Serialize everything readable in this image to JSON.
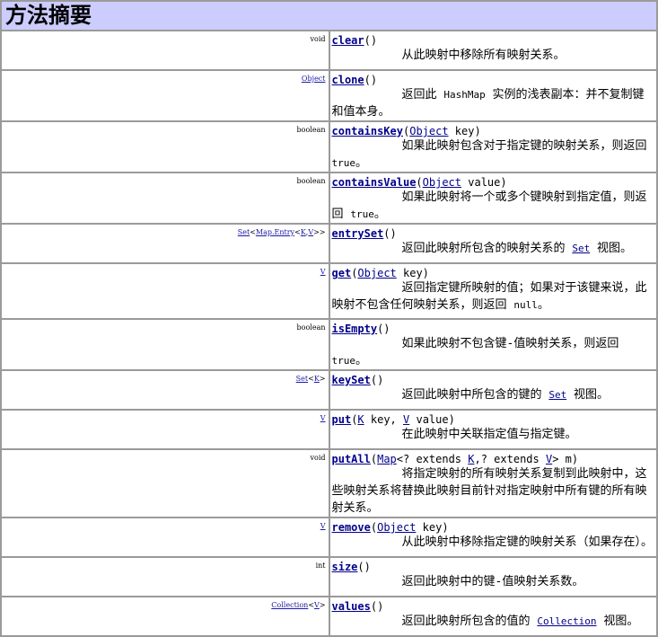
{
  "title": "方法摘要",
  "colors": {
    "header_bg": "#ccccff",
    "link": "#00008b",
    "border": "#9a9a9a"
  },
  "rows": [
    {
      "ret": [
        {
          "t": "void"
        }
      ],
      "name": "clear",
      "params": [
        {
          "t": "()"
        }
      ],
      "desc": [
        {
          "t": "从此映射中移除所有映射关系。"
        }
      ]
    },
    {
      "ret": [
        {
          "t": "Object",
          "link": true
        }
      ],
      "name": "clone",
      "params": [
        {
          "t": "()"
        }
      ],
      "desc": [
        {
          "t": "返回此 "
        },
        {
          "t": "HashMap",
          "mono": true
        },
        {
          "t": " 实例的浅表副本：并不复制键和值本身。"
        }
      ]
    },
    {
      "ret": [
        {
          "t": "boolean"
        }
      ],
      "name": "containsKey",
      "params": [
        {
          "t": "("
        },
        {
          "t": "Object",
          "link": true
        },
        {
          "t": " key)"
        }
      ],
      "desc": [
        {
          "t": "如果此映射包含对于指定键的映射关系，则返回 "
        },
        {
          "t": "true",
          "mono": true
        },
        {
          "t": "。"
        }
      ]
    },
    {
      "ret": [
        {
          "t": "boolean"
        }
      ],
      "name": "containsValue",
      "params": [
        {
          "t": "("
        },
        {
          "t": "Object",
          "link": true
        },
        {
          "t": " value)"
        }
      ],
      "desc": [
        {
          "t": "如果此映射将一个或多个键映射到指定值，则返回 "
        },
        {
          "t": "true",
          "mono": true
        },
        {
          "t": "。"
        }
      ]
    },
    {
      "ret": [
        {
          "t": "Set",
          "link": true
        },
        {
          "t": "<"
        },
        {
          "t": "Map.Entry",
          "link": true
        },
        {
          "t": "<"
        },
        {
          "t": "K",
          "link": true
        },
        {
          "t": ","
        },
        {
          "t": "V",
          "link": true
        },
        {
          "t": ">>"
        }
      ],
      "name": "entrySet",
      "params": [
        {
          "t": "()"
        }
      ],
      "desc": [
        {
          "t": "返回此映射所包含的映射关系的 "
        },
        {
          "t": "Set",
          "link": true,
          "mono": true
        },
        {
          "t": " 视图。"
        }
      ]
    },
    {
      "ret": [
        {
          "t": "V",
          "link": true
        }
      ],
      "name": "get",
      "params": [
        {
          "t": "("
        },
        {
          "t": "Object",
          "link": true
        },
        {
          "t": " key)"
        }
      ],
      "desc": [
        {
          "t": "返回指定键所映射的值；如果对于该键来说，此映射不包含任何映射关系，则返回 "
        },
        {
          "t": "null",
          "mono": true
        },
        {
          "t": "。"
        }
      ]
    },
    {
      "ret": [
        {
          "t": "boolean"
        }
      ],
      "name": "isEmpty",
      "params": [
        {
          "t": "()"
        }
      ],
      "desc": [
        {
          "t": "如果此映射不包含键-值映射关系，则返回 "
        },
        {
          "t": "true",
          "mono": true
        },
        {
          "t": "。"
        }
      ]
    },
    {
      "ret": [
        {
          "t": "Set",
          "link": true
        },
        {
          "t": "<"
        },
        {
          "t": "K",
          "link": true
        },
        {
          "t": ">"
        }
      ],
      "name": "keySet",
      "params": [
        {
          "t": "()"
        }
      ],
      "desc": [
        {
          "t": "返回此映射中所包含的键的 "
        },
        {
          "t": "Set",
          "link": true,
          "mono": true
        },
        {
          "t": " 视图。"
        }
      ]
    },
    {
      "ret": [
        {
          "t": "V",
          "link": true
        }
      ],
      "name": "put",
      "params": [
        {
          "t": "("
        },
        {
          "t": "K",
          "link": true
        },
        {
          "t": " key, "
        },
        {
          "t": "V",
          "link": true
        },
        {
          "t": " value)"
        }
      ],
      "desc": [
        {
          "t": "在此映射中关联指定值与指定键。"
        }
      ]
    },
    {
      "ret": [
        {
          "t": "void"
        }
      ],
      "name": "putAll",
      "params": [
        {
          "t": "("
        },
        {
          "t": "Map",
          "link": true
        },
        {
          "t": "<? extends "
        },
        {
          "t": "K",
          "link": true
        },
        {
          "t": ",? extends "
        },
        {
          "t": "V",
          "link": true
        },
        {
          "t": "> m)"
        }
      ],
      "desc": [
        {
          "t": "将指定映射的所有映射关系复制到此映射中，这些映射关系将替换此映射目前针对指定映射中所有键的所有映射关系。"
        }
      ]
    },
    {
      "ret": [
        {
          "t": "V",
          "link": true
        }
      ],
      "name": "remove",
      "params": [
        {
          "t": "("
        },
        {
          "t": "Object",
          "link": true
        },
        {
          "t": " key)"
        }
      ],
      "desc": [
        {
          "t": "从此映射中移除指定键的映射关系（如果存在）。"
        }
      ]
    },
    {
      "ret": [
        {
          "t": "int"
        }
      ],
      "name": "size",
      "params": [
        {
          "t": "()"
        }
      ],
      "desc": [
        {
          "t": "返回此映射中的键-值映射关系数。"
        }
      ]
    },
    {
      "ret": [
        {
          "t": "Collection",
          "link": true
        },
        {
          "t": "<"
        },
        {
          "t": "V",
          "link": true
        },
        {
          "t": ">"
        }
      ],
      "name": "values",
      "params": [
        {
          "t": "()"
        }
      ],
      "desc": [
        {
          "t": "返回此映射所包含的值的 "
        },
        {
          "t": "Collection",
          "link": true,
          "mono": true
        },
        {
          "t": " 视图。"
        }
      ]
    }
  ]
}
